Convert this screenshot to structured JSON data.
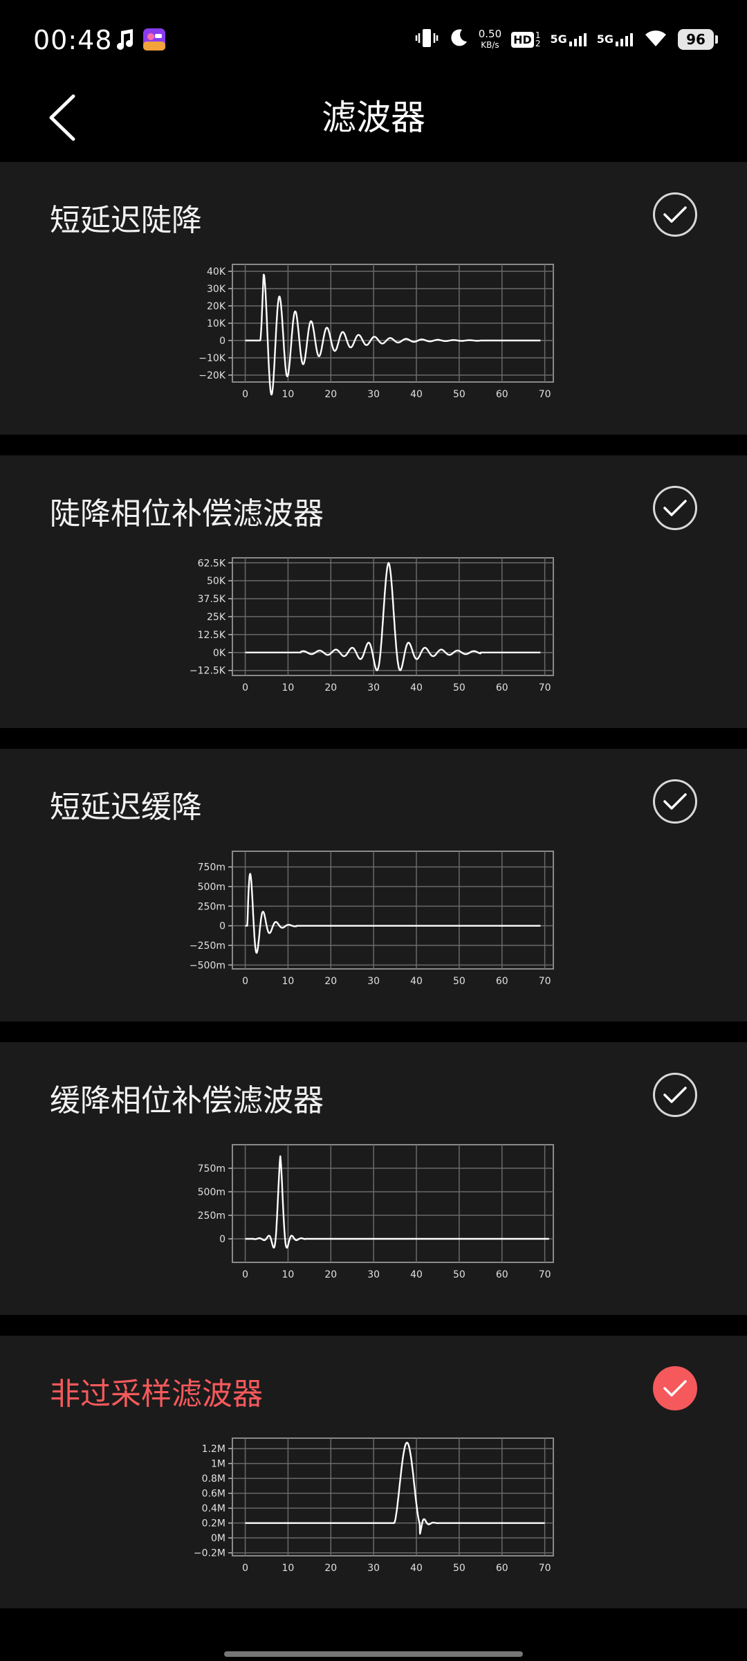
{
  "status": {
    "time": "00:48",
    "speed_value": "0.50",
    "speed_unit": "KB/s",
    "hd_label": "HD",
    "sim1_label": "5G",
    "sim2_label": "5G",
    "battery": "96"
  },
  "header": {
    "title": "滤波器"
  },
  "filters": [
    {
      "title": "短延迟陡降",
      "selected": false,
      "chart_data": {
        "type": "line",
        "x_ticks": [
          0,
          10,
          20,
          30,
          40,
          50,
          60,
          70
        ],
        "y_ticks": [
          "40K",
          "30K",
          "20K",
          "10K",
          "0",
          "−10K",
          "−20K"
        ],
        "y_tick_values": [
          40000,
          30000,
          20000,
          10000,
          0,
          -10000,
          -20000
        ],
        "xlim": [
          -3,
          72
        ],
        "ylim": [
          -24000,
          44000
        ],
        "grid": true
      }
    },
    {
      "title": "陡降相位补偿滤波器",
      "selected": false,
      "chart_data": {
        "type": "line",
        "x_ticks": [
          0,
          10,
          20,
          30,
          40,
          50,
          60,
          70
        ],
        "y_ticks": [
          "62.5K",
          "50K",
          "37.5K",
          "25K",
          "12.5K",
          "0K",
          "−12.5K"
        ],
        "y_tick_values": [
          62500,
          50000,
          37500,
          25000,
          12500,
          0,
          -12500
        ],
        "xlim": [
          -3,
          72
        ],
        "ylim": [
          -16000,
          66000
        ],
        "grid": true
      }
    },
    {
      "title": "短延迟缓降",
      "selected": false,
      "chart_data": {
        "type": "line",
        "x_ticks": [
          0,
          10,
          20,
          30,
          40,
          50,
          60,
          70
        ],
        "y_ticks": [
          "750m",
          "500m",
          "250m",
          "0",
          "−250m",
          "−500m"
        ],
        "y_tick_values": [
          0.75,
          0.5,
          0.25,
          0,
          -0.25,
          -0.5
        ],
        "xlim": [
          -3,
          72
        ],
        "ylim": [
          -0.55,
          0.95
        ],
        "grid": true
      }
    },
    {
      "title": "缓降相位补偿滤波器",
      "selected": false,
      "chart_data": {
        "type": "line",
        "x_ticks": [
          0,
          10,
          20,
          30,
          40,
          50,
          60,
          70
        ],
        "y_ticks": [
          "750m",
          "500m",
          "250m",
          "0"
        ],
        "y_tick_values": [
          0.75,
          0.5,
          0.25,
          0
        ],
        "xlim": [
          -3,
          72
        ],
        "ylim": [
          -0.25,
          1.0
        ],
        "grid": true
      }
    },
    {
      "title": "非过采样滤波器",
      "selected": true,
      "chart_data": {
        "type": "line",
        "x_ticks": [
          0,
          10,
          20,
          30,
          40,
          50,
          60,
          70
        ],
        "y_ticks": [
          "1.2M",
          "1M",
          "0.8M",
          "0.6M",
          "0.4M",
          "0.2M",
          "0M",
          "−0.2M"
        ],
        "y_tick_values": [
          1200000,
          1000000,
          800000,
          600000,
          400000,
          200000,
          0,
          -200000
        ],
        "xlim": [
          -3,
          72
        ],
        "ylim": [
          -240000,
          1340000
        ],
        "grid": true
      }
    }
  ]
}
